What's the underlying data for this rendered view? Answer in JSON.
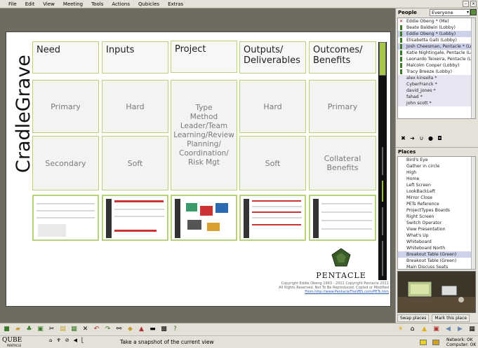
{
  "menu": [
    "File",
    "Edit",
    "View",
    "Meeting",
    "Tools",
    "Actions",
    "Qubicles",
    "Extras"
  ],
  "slide": {
    "vertical_title": "CradleGrave",
    "headers": [
      "Need",
      "Inputs",
      "Project",
      "Outputs/ Deliverables",
      "Outcomes/ Benefits"
    ],
    "row1": [
      "Primary",
      "Hard",
      "Hard",
      "Primary"
    ],
    "row2": [
      "Secondary",
      "Soft",
      "Soft",
      "Collateral Benefits"
    ],
    "project_items": [
      "Type",
      "Method",
      "Leader/Team",
      "Learning/Review",
      "Planning/",
      "Coordination/",
      "Risk Mgt"
    ],
    "logo": "PENTACLE",
    "copyright_lines": [
      "Copyright Eddie Obeng 1993 - 2011 Copyright Pentacle 2011",
      "All Rights Reserved. Not To Be Reproduced, Copied or Modified"
    ],
    "copyright_link": "From http://www.PentacleTheVBS.com/PETs.htm"
  },
  "people": {
    "title": "People",
    "filter": "Everyone",
    "items": [
      {
        "name": "Eddie Obeng * (Me)",
        "state": "me"
      },
      {
        "name": "Beate Baldwin (Lobby)",
        "state": "normal"
      },
      {
        "name": "Eddie Obeng * (Lobby)",
        "state": "sel"
      },
      {
        "name": "Elisabetta Galli (Lobby)",
        "state": "normal"
      },
      {
        "name": "Josh Cheesman, Pentacle * (Lo",
        "state": "sel"
      },
      {
        "name": "Katie Nightingale, Pentacle (Lo",
        "state": "normal"
      },
      {
        "name": "Leonardo Teixeira, Pentacle (Lo",
        "state": "normal"
      },
      {
        "name": "Malcolm Cooper (Lobby)",
        "state": "normal"
      },
      {
        "name": "Tracy Breeze (Lobby)",
        "state": "normal"
      },
      {
        "name": "alex kinsella *",
        "state": "grp2"
      },
      {
        "name": "CyberFranck *",
        "state": "grp2"
      },
      {
        "name": "david_jones *",
        "state": "grp2"
      },
      {
        "name": "fahad *",
        "state": "grp2"
      },
      {
        "name": "john scott *",
        "state": "grp2"
      }
    ]
  },
  "places": {
    "title": "Places",
    "items": [
      "Bird's Eye",
      "Gather in circle",
      "High",
      "Home",
      "Left Screen",
      "LookBackLeft",
      "Mirror Close",
      "PETs Reference",
      "ProjectTypes Boards",
      "Right Screen",
      "Switch Operator",
      "View Presentation",
      "What's Up",
      "Whiteboard",
      "Whiteboard North",
      "Breakout Table (Green)",
      "Breakout Table (Green)",
      "Main Discuss Seats"
    ],
    "selected_index": 15,
    "swap_label": "Swap places",
    "mark_label": "Mark this place"
  },
  "status": {
    "message": "Take a snapshot of the current view",
    "network": "Network: OK",
    "computer": "Computer: OK",
    "brand": "QUBE",
    "brand_sub": "PENTACLE"
  }
}
